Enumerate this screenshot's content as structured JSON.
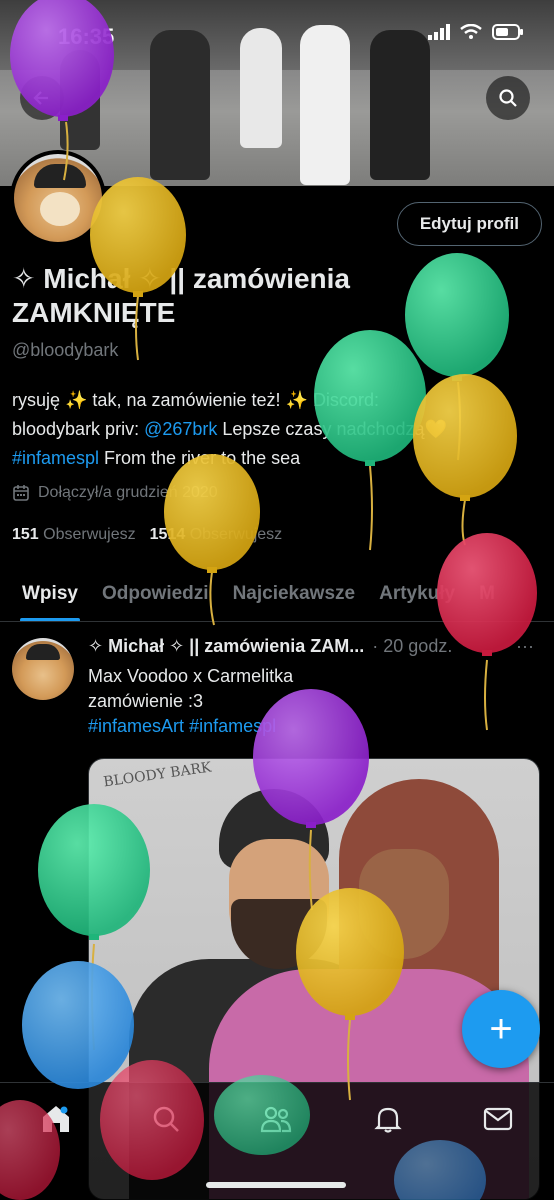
{
  "status_bar": {
    "time": "16:35"
  },
  "profile": {
    "edit_label": "Edytuj profil",
    "name_line1": "✧ Michał ✧ || zamówienia",
    "name_line2": "ZAMKNIĘTE",
    "handle": "@bloodybark",
    "bio": {
      "line1": "rysuję ✨ tak, na zamówienie też! ✨ Discord:",
      "line2_prefix": "bloodybark priv: ",
      "line2_link": "@267brk",
      "line2_suffix": " Lepsze czasy nadchodzą💛",
      "line3_link": "#infamespl",
      "line3_suffix": " From the river to the sea"
    },
    "joined": "Dołączył/a grudzień 2020",
    "following_count": "151",
    "following_label": "Obserwujesz",
    "followers_count": "1514",
    "followers_label": "Obserwujesz"
  },
  "tabs": [
    {
      "label": "Wpisy",
      "active": true
    },
    {
      "label": "Odpowiedzi"
    },
    {
      "label": "Najciekawsze"
    },
    {
      "label": "Artykuły"
    },
    {
      "label": "M"
    }
  ],
  "post": {
    "author": "✧ Michał ✧ || zamówienia ZAM...",
    "time": "· 20 godz.",
    "more": "···",
    "text_line1": "Max Voodoo x Carmelitka",
    "text_line2": "zamówienie :3",
    "tag1": "#infamesArt",
    "tag2": "#infamespl",
    "image_signature": "BLOODY BARK"
  },
  "fab": {
    "icon": "plus-icon",
    "label": "+"
  },
  "bottom_nav": [
    {
      "icon": "home-icon",
      "active": true
    },
    {
      "icon": "search-icon"
    },
    {
      "icon": "communities-icon"
    },
    {
      "icon": "bell-icon"
    },
    {
      "icon": "mail-icon"
    }
  ],
  "colors": {
    "accent": "#1d9bf0",
    "background": "#000000",
    "text": "#e7e9ea",
    "muted": "#71767b",
    "balloon_purple": "#9b2fd6",
    "balloon_yellow": "#e2b51c",
    "balloon_green": "#2fd38f",
    "balloon_red": "#e0254a",
    "balloon_blue": "#3a9ae8"
  }
}
